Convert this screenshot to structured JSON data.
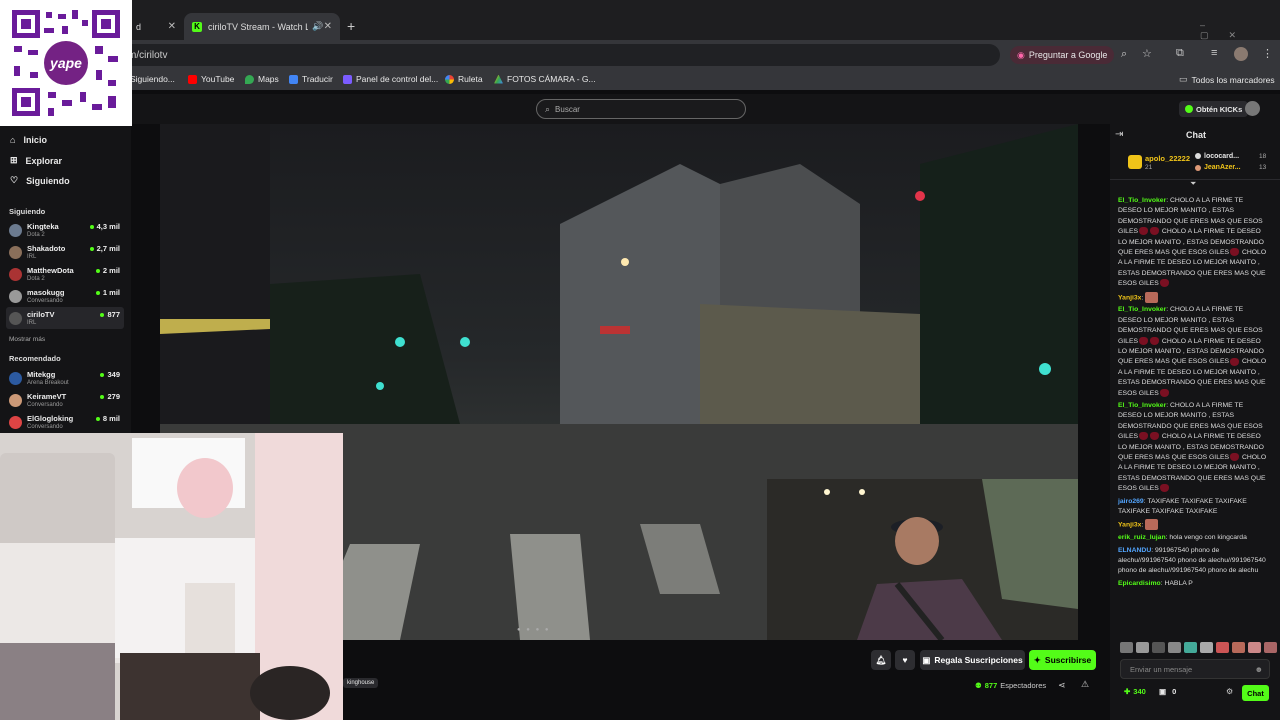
{
  "browser": {
    "tabs": [
      {
        "title": "d",
        "active": false
      },
      {
        "title": "ciriloTV Stream - Watch Liv",
        "active": true
      }
    ],
    "new_tab": "+",
    "url": "m/cirilotv",
    "ask_google": "Preguntar a Google",
    "bookmarks": [
      {
        "label": "Siguiendo...",
        "color": "#444"
      },
      {
        "label": "YouTube",
        "color": "#ff0000"
      },
      {
        "label": "Maps",
        "color": "#34a853"
      },
      {
        "label": "Traducir",
        "color": "#4285f4"
      },
      {
        "label": "Panel de control del...",
        "color": "#7b5cff"
      },
      {
        "label": "Ruleta",
        "color": "#fbbc05"
      },
      {
        "label": "FOTOS CÁMARA - G...",
        "color": "#34a853"
      }
    ],
    "all_bookmarks": "Todos los marcadores"
  },
  "site": {
    "search_placeholder": "Buscar",
    "get_kicks": "Obtén KICKs"
  },
  "sidebar": {
    "nav": [
      {
        "label": "Inicio",
        "icon": "home-icon"
      },
      {
        "label": "Explorar",
        "icon": "compass-icon"
      },
      {
        "label": "Siguiendo",
        "icon": "heart-icon"
      }
    ],
    "following_title": "Siguiendo",
    "following": [
      {
        "name": "Kingteka",
        "category": "Dota 2",
        "viewers": "4,3 mil",
        "color": "#6b7a8f"
      },
      {
        "name": "Shakadoto",
        "category": "IRL",
        "viewers": "2,7 mil",
        "color": "#8a6f5a"
      },
      {
        "name": "MatthewDota",
        "category": "Dota 2",
        "viewers": "2 mil",
        "color": "#a33"
      },
      {
        "name": "masokugg",
        "category": "Conversando",
        "viewers": "1 mil",
        "color": "#999"
      },
      {
        "name": "ciriloTV",
        "category": "IRL",
        "viewers": "877",
        "color": "#555"
      }
    ],
    "show_more": "Mostrar más",
    "recommended_title": "Recomendado",
    "recommended": [
      {
        "name": "Mitekgg",
        "category": "Arena Breakout",
        "viewers": "349",
        "color": "#2c5aa0"
      },
      {
        "name": "KeirameVT",
        "category": "Conversando",
        "viewers": "279",
        "color": "#c97"
      },
      {
        "name": "ElGlogloking",
        "category": "Conversando",
        "viewers": "8 mil",
        "color": "#d44"
      }
    ]
  },
  "player": {
    "regala": "Regala Suscripciones",
    "suscribirse": "Suscribirse",
    "viewers_count": "877",
    "viewers_label": "Espectadores",
    "overlay_tag": "kinghouse"
  },
  "chat": {
    "title": "Chat",
    "gifters": [
      {
        "name": "apolo_22222",
        "count": "21"
      },
      {
        "name": "lococard...",
        "count": "18"
      },
      {
        "name": "JeanAzer...",
        "count": "13"
      }
    ],
    "messages": [
      {
        "user": "El_Tio_Invoker",
        "color": "#53fc18",
        "text": "CHOLO A LA FIRME TE DESEO LO MEJOR MANITO , ESTAS DEMOSTRANDO QUE ERES MAS QUE ESOS GILES",
        "emotes": 2,
        "extra": "CHOLO A LA FIRME TE DESEO LO MEJOR MANITO , ESTAS DEMOSTRANDO QUE ERES MAS QUE ESOS GILES",
        "extra2": "CHOLO A LA FIRME TE DESEO LO MEJOR MANITO , ESTAS DEMOSTRANDO QUE ERES MAS QUE ESOS GILES"
      },
      {
        "user": "Yanji3x",
        "color": "#f0c419",
        "text": "",
        "emotes": 0
      },
      {
        "user": "El_Tio_Invoker",
        "color": "#53fc18",
        "text": "CHOLO A LA FIRME TE DESEO LO MEJOR MANITO , ESTAS DEMOSTRANDO QUE ERES MAS QUE ESOS GILES",
        "emotes": 2,
        "extra": "CHOLO A LA FIRME TE DESEO LO MEJOR MANITO , ESTAS DEMOSTRANDO QUE ERES MAS QUE ESOS GILES",
        "extra2": "CHOLO A LA FIRME TE DESEO LO MEJOR MANITO , ESTAS DEMOSTRANDO QUE ERES MAS QUE ESOS GILES"
      },
      {
        "user": "El_Tio_Invoker",
        "color": "#53fc18",
        "text": "CHOLO A LA FIRME TE DESEO LO MEJOR MANITO , ESTAS DEMOSTRANDO QUE ERES MAS QUE ESOS GILES",
        "emotes": 2,
        "extra": "CHOLO A LA FIRME TE DESEO LO MEJOR MANITO , ESTAS DEMOSTRANDO QUE ERES MAS QUE ESOS GILES",
        "extra2": "CHOLO A LA FIRME TE DESEO LO MEJOR MANITO , ESTAS DEMOSTRANDO QUE ERES MAS QUE ESOS GILES"
      },
      {
        "user": "jairo269",
        "color": "#53a6ff",
        "text": "TAXIFAKE TAXIFAKE TAXIFAKE TAXIFAKE TAXIFAKE TAXIFAKE",
        "emotes": 0
      },
      {
        "user": "Yanji3x",
        "color": "#f0c419",
        "text": "",
        "emotes": 0
      },
      {
        "user": "erik_ruiz_lujan",
        "color": "#53fc18",
        "text": "hola vengo con kingcarda",
        "emotes": 0
      },
      {
        "user": "ELNANDU",
        "color": "#53a6ff",
        "text": "991967540 phono de alechu//991967540 phono de alechu//991967540 phono de alechu//991967540 phono de alechu",
        "emotes": 0
      },
      {
        "user": "Epicardisimo",
        "color": "#53fc18",
        "text": "HABLA P",
        "emotes": 0
      }
    ],
    "input_placeholder": "Enviar un mensaje",
    "points": "340",
    "gifts": "0",
    "send_label": "Chat"
  }
}
